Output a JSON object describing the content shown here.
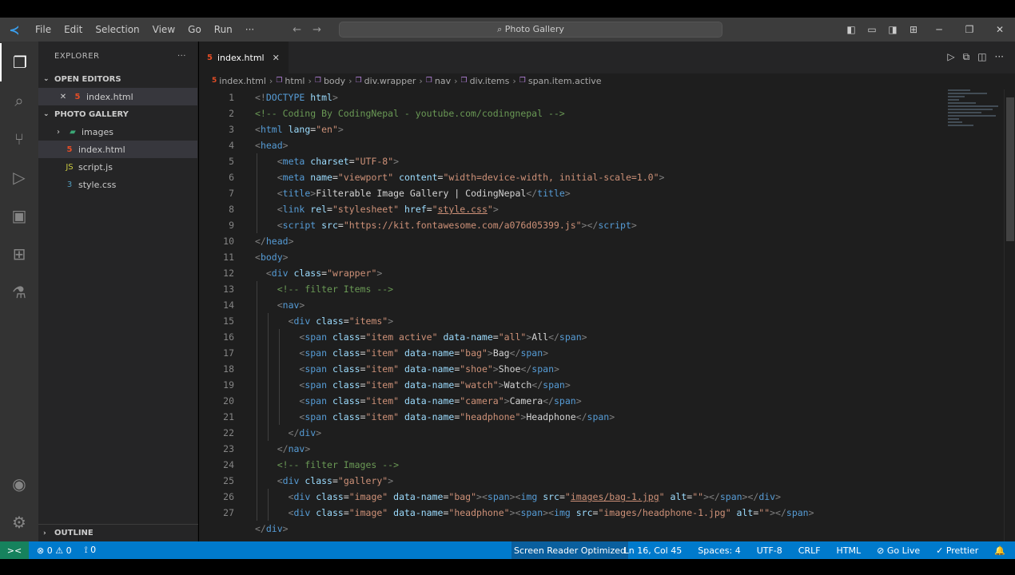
{
  "titlebar": {
    "menu": [
      "File",
      "Edit",
      "Selection",
      "View",
      "Go",
      "Run",
      "···"
    ],
    "command_center": "Photo Gallery"
  },
  "activitybar": {
    "icons": [
      "files-icon",
      "search-icon",
      "source-control-icon",
      "run-debug-icon",
      "remote-explorer-icon",
      "extensions-icon",
      "testing-icon"
    ],
    "bottom_icons": [
      "account-icon",
      "settings-gear-icon"
    ]
  },
  "sidebar": {
    "title": "EXPLORER",
    "open_editors_label": "OPEN EDITORS",
    "open_editors": [
      {
        "name": "index.html",
        "close": "✕"
      }
    ],
    "folder_label": "PHOTO GALLERY",
    "files": [
      {
        "name": "images",
        "kind": "folder"
      },
      {
        "name": "index.html",
        "kind": "html"
      },
      {
        "name": "script.js",
        "kind": "js"
      },
      {
        "name": "style.css",
        "kind": "css"
      }
    ],
    "outline_label": "OUTLINE"
  },
  "editor": {
    "tab_label": "index.html",
    "breadcrumbs": [
      "index.html",
      "html",
      "body",
      "div.wrapper",
      "nav",
      "div.items",
      "span.item.active"
    ],
    "lines": [
      {
        "n": "1",
        "indent": 0,
        "parts": [
          [
            "tg",
            "<!"
          ],
          [
            "tn",
            "DOCTYPE"
          ],
          [
            "an",
            " html"
          ],
          [
            "tg",
            ">"
          ]
        ]
      },
      {
        "n": "2",
        "indent": 0,
        "parts": [
          [
            "cm",
            "<!-- Coding By CodingNepal - youtube.com/codingnepal -->"
          ]
        ]
      },
      {
        "n": "3",
        "indent": 0,
        "parts": [
          [
            "tg",
            "<"
          ],
          [
            "tn",
            "html"
          ],
          [
            "an",
            " lang"
          ],
          [
            "tx",
            "="
          ],
          [
            "av",
            "\"en\""
          ],
          [
            "tg",
            ">"
          ]
        ]
      },
      {
        "n": "4",
        "indent": 0,
        "parts": [
          [
            "tg",
            "<"
          ],
          [
            "tn",
            "head"
          ],
          [
            "tg",
            ">"
          ]
        ]
      },
      {
        "n": "5",
        "indent": 2,
        "parts": [
          [
            "tg",
            "<"
          ],
          [
            "tn",
            "meta"
          ],
          [
            "an",
            " charset"
          ],
          [
            "tx",
            "="
          ],
          [
            "av",
            "\"UTF-8\""
          ],
          [
            "tg",
            ">"
          ]
        ]
      },
      {
        "n": "6",
        "indent": 2,
        "parts": [
          [
            "tg",
            "<"
          ],
          [
            "tn",
            "meta"
          ],
          [
            "an",
            " name"
          ],
          [
            "tx",
            "="
          ],
          [
            "av",
            "\"viewport\""
          ],
          [
            "an",
            " content"
          ],
          [
            "tx",
            "="
          ],
          [
            "av",
            "\"width=device-width, initial-scale=1.0\""
          ],
          [
            "tg",
            ">"
          ]
        ]
      },
      {
        "n": "7",
        "indent": 2,
        "parts": [
          [
            "tg",
            "<"
          ],
          [
            "tn",
            "title"
          ],
          [
            "tg",
            ">"
          ],
          [
            "tx",
            "Filterable Image Gallery | CodingNepal"
          ],
          [
            "tg",
            "</"
          ],
          [
            "tn",
            "title"
          ],
          [
            "tg",
            ">"
          ]
        ]
      },
      {
        "n": "8",
        "indent": 2,
        "parts": [
          [
            "tg",
            "<"
          ],
          [
            "tn",
            "link"
          ],
          [
            "an",
            " rel"
          ],
          [
            "tx",
            "="
          ],
          [
            "av",
            "\"stylesheet\""
          ],
          [
            "an",
            " href"
          ],
          [
            "tx",
            "="
          ],
          [
            "av",
            "\""
          ],
          [
            "avu",
            "style.css"
          ],
          [
            "av",
            "\""
          ],
          [
            "tg",
            ">"
          ]
        ]
      },
      {
        "n": "9",
        "indent": 2,
        "parts": [
          [
            "tg",
            "<"
          ],
          [
            "tn",
            "script"
          ],
          [
            "an",
            " src"
          ],
          [
            "tx",
            "="
          ],
          [
            "av",
            "\"https://kit.fontawesome.com/a076d05399.js\""
          ],
          [
            "tg",
            "></"
          ],
          [
            "tn",
            "script"
          ],
          [
            "tg",
            ">"
          ]
        ]
      },
      {
        "n": "10",
        "indent": 0,
        "parts": [
          [
            "tg",
            "</"
          ],
          [
            "tn",
            "head"
          ],
          [
            "tg",
            ">"
          ]
        ]
      },
      {
        "n": "11",
        "indent": 0,
        "parts": [
          [
            "tg",
            "<"
          ],
          [
            "tn",
            "body"
          ],
          [
            "tg",
            ">"
          ]
        ]
      },
      {
        "n": "12",
        "indent": 1,
        "parts": [
          [
            "tg",
            "<"
          ],
          [
            "tn",
            "div"
          ],
          [
            "an",
            " class"
          ],
          [
            "tx",
            "="
          ],
          [
            "av",
            "\"wrapper\""
          ],
          [
            "tg",
            ">"
          ]
        ]
      },
      {
        "n": "13",
        "indent": 2,
        "parts": [
          [
            "cm",
            "<!-- filter Items -->"
          ]
        ]
      },
      {
        "n": "14",
        "indent": 2,
        "parts": [
          [
            "tg",
            "<"
          ],
          [
            "tn",
            "nav"
          ],
          [
            "tg",
            ">"
          ]
        ]
      },
      {
        "n": "15",
        "indent": 3,
        "parts": [
          [
            "tg",
            "<"
          ],
          [
            "tn",
            "div"
          ],
          [
            "an",
            " class"
          ],
          [
            "tx",
            "="
          ],
          [
            "av",
            "\"items\""
          ],
          [
            "tg",
            ">"
          ]
        ]
      },
      {
        "n": "16",
        "indent": 4,
        "parts": [
          [
            "tg",
            "<"
          ],
          [
            "tn",
            "span"
          ],
          [
            "an",
            " class"
          ],
          [
            "tx",
            "="
          ],
          [
            "av",
            "\"item active\""
          ],
          [
            "an",
            " data-name"
          ],
          [
            "tx",
            "="
          ],
          [
            "av",
            "\"all\""
          ],
          [
            "tg",
            ">"
          ],
          [
            "tx",
            "All"
          ],
          [
            "tg",
            "</"
          ],
          [
            "tn",
            "span"
          ],
          [
            "tg",
            ">"
          ]
        ]
      },
      {
        "n": "17",
        "indent": 4,
        "parts": [
          [
            "tg",
            "<"
          ],
          [
            "tn",
            "span"
          ],
          [
            "an",
            " class"
          ],
          [
            "tx",
            "="
          ],
          [
            "av",
            "\"item\""
          ],
          [
            "an",
            " data-name"
          ],
          [
            "tx",
            "="
          ],
          [
            "av",
            "\"bag\""
          ],
          [
            "tg",
            ">"
          ],
          [
            "tx",
            "Bag"
          ],
          [
            "tg",
            "</"
          ],
          [
            "tn",
            "span"
          ],
          [
            "tg",
            ">"
          ]
        ]
      },
      {
        "n": "18",
        "indent": 4,
        "parts": [
          [
            "tg",
            "<"
          ],
          [
            "tn",
            "span"
          ],
          [
            "an",
            " class"
          ],
          [
            "tx",
            "="
          ],
          [
            "av",
            "\"item\""
          ],
          [
            "an",
            " data-name"
          ],
          [
            "tx",
            "="
          ],
          [
            "av",
            "\"shoe\""
          ],
          [
            "tg",
            ">"
          ],
          [
            "tx",
            "Shoe"
          ],
          [
            "tg",
            "</"
          ],
          [
            "tn",
            "span"
          ],
          [
            "tg",
            ">"
          ]
        ]
      },
      {
        "n": "19",
        "indent": 4,
        "parts": [
          [
            "tg",
            "<"
          ],
          [
            "tn",
            "span"
          ],
          [
            "an",
            " class"
          ],
          [
            "tx",
            "="
          ],
          [
            "av",
            "\"item\""
          ],
          [
            "an",
            " data-name"
          ],
          [
            "tx",
            "="
          ],
          [
            "av",
            "\"watch\""
          ],
          [
            "tg",
            ">"
          ],
          [
            "tx",
            "Watch"
          ],
          [
            "tg",
            "</"
          ],
          [
            "tn",
            "span"
          ],
          [
            "tg",
            ">"
          ]
        ]
      },
      {
        "n": "20",
        "indent": 4,
        "parts": [
          [
            "tg",
            "<"
          ],
          [
            "tn",
            "span"
          ],
          [
            "an",
            " class"
          ],
          [
            "tx",
            "="
          ],
          [
            "av",
            "\"item\""
          ],
          [
            "an",
            " data-name"
          ],
          [
            "tx",
            "="
          ],
          [
            "av",
            "\"camera\""
          ],
          [
            "tg",
            ">"
          ],
          [
            "tx",
            "Camera"
          ],
          [
            "tg",
            "</"
          ],
          [
            "tn",
            "span"
          ],
          [
            "tg",
            ">"
          ]
        ]
      },
      {
        "n": "21",
        "indent": 4,
        "parts": [
          [
            "tg",
            "<"
          ],
          [
            "tn",
            "span"
          ],
          [
            "an",
            " class"
          ],
          [
            "tx",
            "="
          ],
          [
            "av",
            "\"item\""
          ],
          [
            "an",
            " data-name"
          ],
          [
            "tx",
            "="
          ],
          [
            "av",
            "\"headphone\""
          ],
          [
            "tg",
            ">"
          ],
          [
            "tx",
            "Headphone"
          ],
          [
            "tg",
            "</"
          ],
          [
            "tn",
            "span"
          ],
          [
            "tg",
            ">"
          ]
        ]
      },
      {
        "n": "22",
        "indent": 3,
        "parts": [
          [
            "tg",
            "</"
          ],
          [
            "tn",
            "div"
          ],
          [
            "tg",
            ">"
          ]
        ]
      },
      {
        "n": "23",
        "indent": 2,
        "parts": [
          [
            "tg",
            "</"
          ],
          [
            "tn",
            "nav"
          ],
          [
            "tg",
            ">"
          ]
        ]
      },
      {
        "n": "24",
        "indent": 2,
        "parts": [
          [
            "cm",
            "<!-- filter Images -->"
          ]
        ]
      },
      {
        "n": "25",
        "indent": 2,
        "parts": [
          [
            "tg",
            "<"
          ],
          [
            "tn",
            "div"
          ],
          [
            "an",
            " class"
          ],
          [
            "tx",
            "="
          ],
          [
            "av",
            "\"gallery\""
          ],
          [
            "tg",
            ">"
          ]
        ]
      },
      {
        "n": "26",
        "indent": 3,
        "parts": [
          [
            "tg",
            "<"
          ],
          [
            "tn",
            "div"
          ],
          [
            "an",
            " class"
          ],
          [
            "tx",
            "="
          ],
          [
            "av",
            "\"image\""
          ],
          [
            "an",
            " data-name"
          ],
          [
            "tx",
            "="
          ],
          [
            "av",
            "\"bag\""
          ],
          [
            "tg",
            ">"
          ],
          [
            "tg",
            "<"
          ],
          [
            "tn",
            "span"
          ],
          [
            "tg",
            ">"
          ],
          [
            "tg",
            "<"
          ],
          [
            "tn",
            "img"
          ],
          [
            "an",
            " src"
          ],
          [
            "tx",
            "="
          ],
          [
            "av",
            "\""
          ],
          [
            "avu",
            "images/bag-1.jpg"
          ],
          [
            "av",
            "\""
          ],
          [
            "an",
            " alt"
          ],
          [
            "tx",
            "="
          ],
          [
            "av",
            "\"\""
          ],
          [
            "tg",
            "></"
          ],
          [
            "tn",
            "span"
          ],
          [
            "tg",
            "></"
          ],
          [
            "tn",
            "div"
          ],
          [
            "tg",
            ">"
          ]
        ]
      },
      {
        "n": "27",
        "indent": 3,
        "parts": [
          [
            "tg",
            "<"
          ],
          [
            "tn",
            "div"
          ],
          [
            "an",
            " class"
          ],
          [
            "tx",
            "="
          ],
          [
            "av",
            "\"image\""
          ],
          [
            "an",
            " data-name"
          ],
          [
            "tx",
            "="
          ],
          [
            "av",
            "\"headphone\""
          ],
          [
            "tg",
            ">"
          ],
          [
            "tg",
            "<"
          ],
          [
            "tn",
            "span"
          ],
          [
            "tg",
            ">"
          ],
          [
            "tg",
            "<"
          ],
          [
            "tn",
            "img"
          ],
          [
            "an",
            " src"
          ],
          [
            "tx",
            "="
          ],
          [
            "av",
            "\"images/headphone-1.jpg\""
          ],
          [
            "an",
            " alt"
          ],
          [
            "tx",
            "="
          ],
          [
            "av",
            "\"\""
          ],
          [
            "tg",
            "></"
          ],
          [
            "tn",
            "span"
          ],
          [
            "tg",
            ">"
          ]
        ]
      },
      {
        "n": "",
        "indent": 0,
        "parts": [
          [
            "tg",
            "</"
          ],
          [
            "tn",
            "div"
          ],
          [
            "tg",
            ">"
          ]
        ]
      }
    ]
  },
  "statusbar": {
    "remote": "><",
    "problems": "⊗ 0 ⚠ 0",
    "ports": "⟟ 0",
    "goal": "Screen Reader Optimized",
    "position": "Ln 16, Col 45",
    "spaces": "Spaces: 4",
    "encoding": "UTF-8",
    "eol": "CRLF",
    "language": "HTML",
    "live": "⊘ Go Live",
    "prettier": "✓ Prettier",
    "bell": "🔔"
  }
}
